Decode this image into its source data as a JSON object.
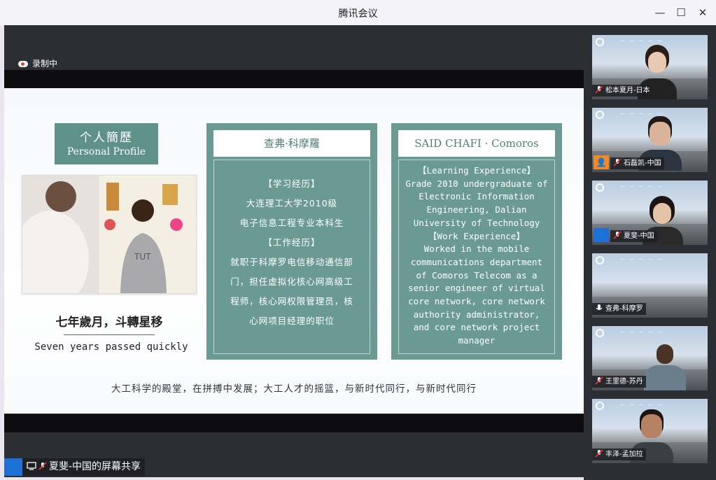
{
  "window": {
    "title": "腾讯会议",
    "minimize_icon": "minimize-icon",
    "maximize_icon": "maximize-icon",
    "close_icon": "close-icon"
  },
  "recording": {
    "label": "录制中",
    "icon": "cloud-record-icon"
  },
  "slide": {
    "profile_title_cn": "个人簡歷",
    "profile_title_en": "Personal Profile",
    "motto_cn": "七年歲月，斗轉星移",
    "motto_en": "Seven years passed quickly",
    "card_cn": {
      "name": "查弗·科摩羅",
      "edu_heading": "【学习经历】",
      "edu_lines": [
        "大连理工大学2010级",
        "电子信息工程专业本科生"
      ],
      "work_heading": "【工作经历】",
      "work_lines": [
        "就职于科摩罗电信移动通信部",
        "门，担任虚拟化核心网高级工",
        "程师，核心网权限管理员，核",
        "心网项目经理的职位"
      ]
    },
    "card_en": {
      "name": "SAID CHAFI · Comoros",
      "edu_heading": "【Learning Experience】",
      "edu_lines": [
        "Grade 2010 undergraduate of",
        "Electronic Information",
        "Engineering, Dalian",
        "University of Technology"
      ],
      "work_heading": "【Work Experience】",
      "work_lines": [
        "Worked in the mobile",
        "communications department",
        "of Comoros Telecom as a",
        "senior engineer of virtual",
        "core network, core network",
        "authority administrator,",
        "and core network project",
        "manager"
      ]
    },
    "bottom_text": "大工科学的殿堂，在拼搏中发展；大工人才的摇篮，与新时代同行，与新时代同行"
  },
  "participants": [
    {
      "name": "松本夏月-日本",
      "badge": ""
    },
    {
      "name": "石磊凯-中国",
      "badge": "orange"
    },
    {
      "name": "夏斐-中国",
      "badge": "blue"
    },
    {
      "name": "查弗-科摩罗",
      "badge": ""
    },
    {
      "name": "王里德-苏丹",
      "badge": ""
    },
    {
      "name": "丰泽-孟加拉",
      "badge": ""
    }
  ],
  "share_bar": {
    "label": "夏斐-中国的屏幕共享"
  },
  "colors": {
    "teal": "#6b9a94",
    "dark_panel": "#2b2e33",
    "user_blue": "#1f6fd6",
    "user_orange": "#f08a24"
  }
}
